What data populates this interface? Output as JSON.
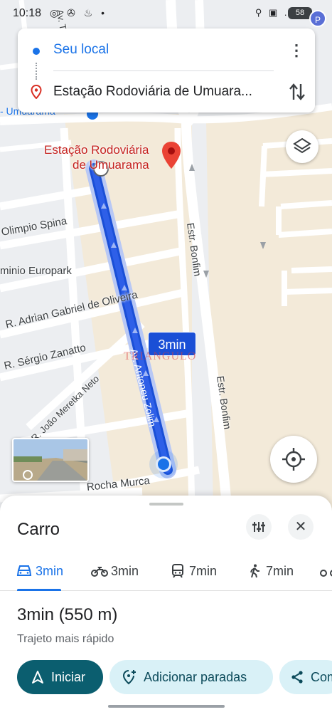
{
  "status_bar": {
    "time": "10:18",
    "left_icons": "◎ ✇ ♨ •",
    "right_icons": "⚲ ▣ .ıl",
    "battery": "58",
    "profile_initial": "P"
  },
  "route_card": {
    "origin": "Seu local",
    "destination": "Estação Rodoviária de Umuara..."
  },
  "map": {
    "streets": [
      "Olimpio Spina",
      "minio Europark",
      "R. Adrian Gabriel de Oliveira",
      "R. Sérgio Zanatto",
      "R. João Meretka Neto",
      "Av. Tancredo Neves",
      "Estr. Bonfim",
      "Estr. Bonfim",
      "Rocha Murca",
      "- Umuarama",
      "Av. Antoneu Zolim"
    ],
    "destination_label_line1": "Estação Rodoviária",
    "destination_label_line2": "de Umuarama",
    "eta_bubble": "3min",
    "watermark": "TRIANGULO",
    "route_color": "#1a4fd6"
  },
  "sheet": {
    "mode_title": "Carro",
    "tabs": [
      {
        "label": "3min",
        "icon": "car-icon"
      },
      {
        "label": "3min",
        "icon": "motorcycle-icon"
      },
      {
        "label": "7min",
        "icon": "transit-icon"
      },
      {
        "label": "7min",
        "icon": "walk-icon"
      }
    ],
    "summary_time": "3min (550 m)",
    "summary_sub": "Trajeto mais rápido",
    "start_label": "Iniciar",
    "add_stops_label": "Adicionar paradas",
    "share_label": "Com",
    "accent": "#1a73e8"
  }
}
